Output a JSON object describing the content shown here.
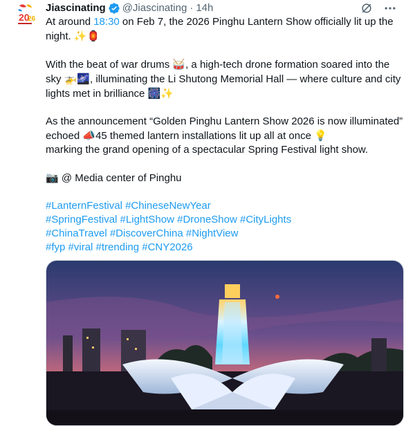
{
  "author": {
    "name": "Jiascinating",
    "handle": "@Jiascinating",
    "time": "14h",
    "dot": "·"
  },
  "icons": {
    "verified": "verified-badge-icon",
    "grok": "grok-icon",
    "more": "more-icon"
  },
  "tweet": {
    "p1": {
      "before_time": "At around ",
      "time_link": "18:30",
      "after_time": " on Feb 7, the 2026 Pinghu Lantern Show officially lit up the night. ",
      "emoji": "✨🏮"
    },
    "p2": {
      "a": "With the beat of war drums ",
      "e1": "🥁",
      "b": ", a high-tech drone formation soared into the sky ",
      "e2": "🚁🌌",
      "c": ", illuminating the Li Shutong Memorial Hall — where culture and city lights met in brilliance ",
      "e3": "🎆✨"
    },
    "p3": {
      "a": "As the announcement “Golden Pinghu Lantern Show 2026 is now illuminated” echoed ",
      "e1": "📣",
      "b": "45 themed lantern installations lit up all at once ",
      "e2": "💡",
      "c": "marking the grand opening of a spectacular Spring Festival light show."
    },
    "p4": {
      "e1": "📷",
      "text": " @ Media center of Pinghu"
    },
    "hashtags": [
      "#LanternFestival #ChineseNewYear",
      "#SpringFestival #LightShow #DroneShow #CityLights",
      "#ChinaTravel #DiscoverChina #NightView",
      "#fyp #viral #trending #CNY2026"
    ]
  },
  "colors": {
    "link": "#1d9bf0",
    "text": "#0f1419",
    "muted": "#536471"
  }
}
